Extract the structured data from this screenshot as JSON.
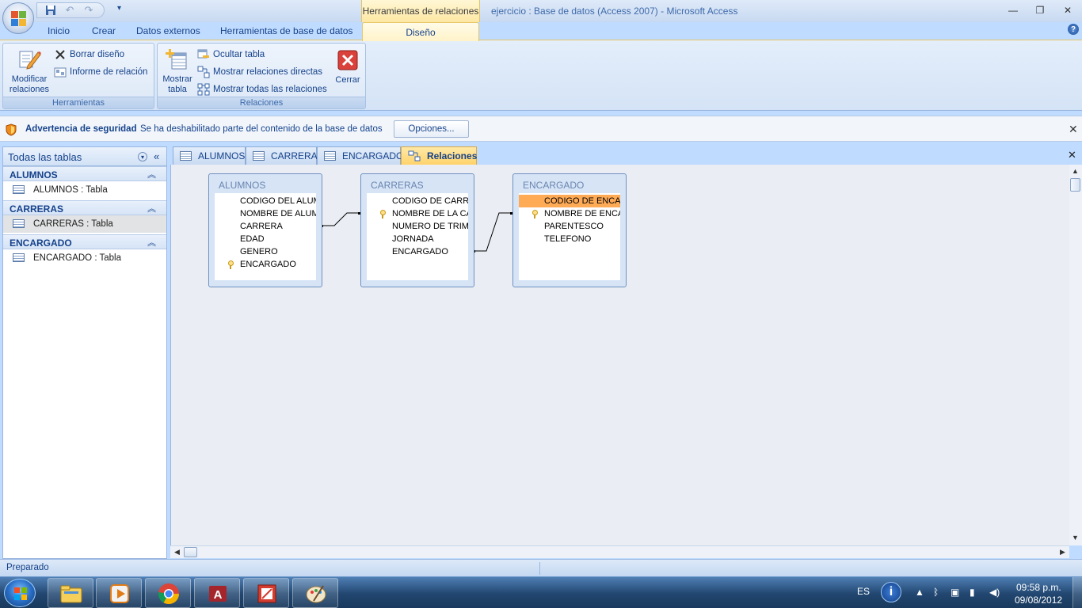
{
  "window": {
    "context_tab_header": "Herramientas de relaciones",
    "title_doc": "ejercicio : Base de datos (Access 2007)",
    "title_sep": " - ",
    "title_app": "Microsoft Access"
  },
  "ribbon": {
    "tabs": [
      "Inicio",
      "Crear",
      "Datos externos",
      "Herramientas de base de datos"
    ],
    "active_tab": "Diseño",
    "groups": {
      "herramientas": {
        "label": "Herramientas",
        "modificar_line1": "Modificar",
        "modificar_line2": "relaciones",
        "borrar": "Borrar diseño",
        "informe": "Informe de relación"
      },
      "relaciones": {
        "label": "Relaciones",
        "mostrar_line1": "Mostrar",
        "mostrar_line2": "tabla",
        "ocultar": "Ocultar tabla",
        "directas": "Mostrar relaciones directas",
        "todas": "Mostrar todas las relaciones",
        "cerrar": "Cerrar"
      }
    }
  },
  "security_bar": {
    "title": "Advertencia de seguridad",
    "message": "Se ha deshabilitado parte del contenido de la base de datos",
    "options_label": "Opciones..."
  },
  "nav": {
    "title": "Todas las tablas",
    "groups": [
      {
        "name": "ALUMNOS",
        "items": [
          "ALUMNOS : Tabla"
        ]
      },
      {
        "name": "CARRERAS",
        "items": [
          "CARRERAS : Tabla"
        ]
      },
      {
        "name": "ENCARGADO",
        "items": [
          "ENCARGADO : Tabla"
        ]
      }
    ]
  },
  "doc_tabs": [
    "ALUMNOS",
    "CARRERAS",
    "ENCARGADO",
    "Relaciones"
  ],
  "relationships": {
    "tables": [
      {
        "name": "ALUMNOS",
        "fields": [
          "CODIGO DEL ALUM",
          "NOMBRE DE ALUM",
          "CARRERA",
          "EDAD",
          "GENERO",
          "ENCARGADO"
        ],
        "key_field_index": 5
      },
      {
        "name": "CARRERAS",
        "fields": [
          "CODIGO DE CARRE",
          "NOMBRE DE LA CA",
          "NUMERO DE TRIME",
          "JORNADA",
          "ENCARGADO"
        ],
        "key_field_index": 1
      },
      {
        "name": "ENCARGADO",
        "fields": [
          "CODIGO DE ENCAR",
          "NOMBRE DE ENCAI",
          "PARENTESCO",
          "TELEFONO"
        ],
        "key_field_index": 1,
        "highlighted_index": 0
      }
    ]
  },
  "status": {
    "text": "Preparado"
  },
  "taskbar": {
    "language": "ES",
    "time": "09:58 p.m.",
    "date": "09/08/2012"
  },
  "colors": {
    "accent": "#15428b",
    "highlight_field": "#ffaa55",
    "active_doc_tab": "#ffd36b"
  }
}
